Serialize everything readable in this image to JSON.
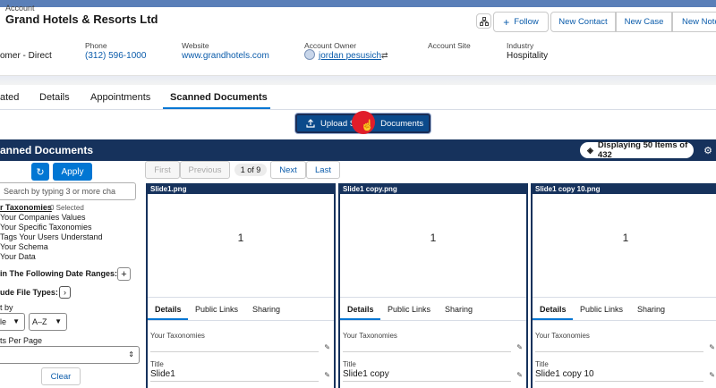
{
  "colors": {
    "brand_blue": "#0176d3",
    "navy": "#16325c",
    "cursor_red": "#e11d2a"
  },
  "account": {
    "label": "Account",
    "name": "Grand Hotels & Resorts Ltd"
  },
  "header_buttons": {
    "follow": "Follow",
    "new_contact": "New Contact",
    "new_case": "New Case",
    "new_note": "New Note"
  },
  "fields": {
    "type_value": "omer - Direct",
    "phone_label": "Phone",
    "phone_value": "(312) 596-1000",
    "website_label": "Website",
    "website_value": "www.grandhotels.com",
    "owner_label": "Account Owner",
    "owner_value": "jordan pesusich",
    "site_label": "Account Site",
    "industry_label": "Industry",
    "industry_value": "Hospitality"
  },
  "tabs": [
    "ated",
    "Details",
    "Appointments",
    "Scanned Documents"
  ],
  "upload_button": "Upload S",
  "upload_button_tail": "Documents",
  "section_title": "anned Documents",
  "display_text": "Displaying 50 Items of 432",
  "filters": {
    "apply": "Apply",
    "search_placeholder": "Search by typing 3 or more cha",
    "taxonomies_label": "r Taxonomies",
    "selected": "0 Selected",
    "taxonomy_items": [
      "Your Companies Values",
      "Your Specific Taxonomies",
      "Tags Your Users Understand",
      "Your Schema",
      "Your Data"
    ],
    "date_ranges": "in The Following Date Ranges:",
    "file_types": "ude File Types:",
    "sort_by": "t by",
    "sort_field": "le",
    "sort_order": "A–Z",
    "per_page": "ts Per Page",
    "clear": "Clear"
  },
  "pagination": {
    "first": "First",
    "previous": "Previous",
    "page": "1 of 9",
    "next": "Next",
    "last": "Last"
  },
  "cards": [
    {
      "file": "Slide1.png",
      "preview": "1",
      "title": "Slide1"
    },
    {
      "file": "Slide1 copy.png",
      "preview": "1",
      "title": "Slide1 copy"
    },
    {
      "file": "Slide1 copy 10.png",
      "preview": "1",
      "title": "Slide1 copy 10"
    }
  ],
  "card_tabs": {
    "details": "Details",
    "links": "Public Links",
    "sharing": "Sharing"
  },
  "card_labels": {
    "taxonomies": "Your Taxonomies",
    "title": "Title"
  }
}
